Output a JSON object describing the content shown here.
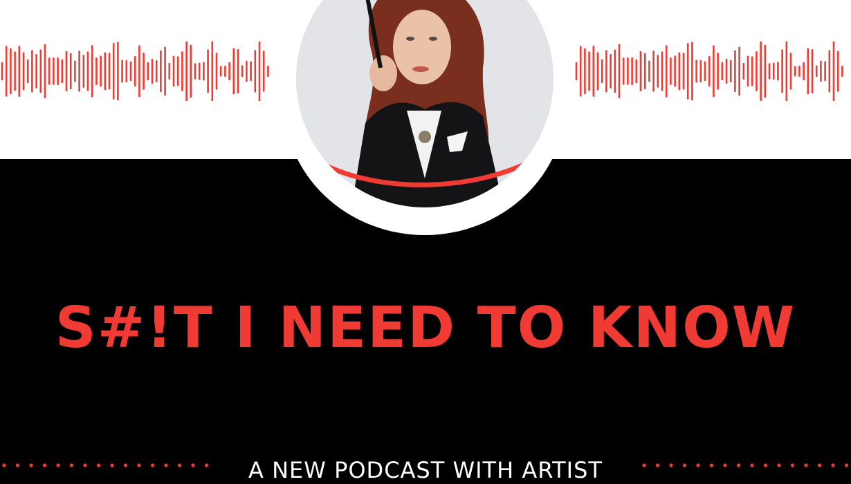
{
  "graphic": {
    "title": "S#!T I NEED TO KNOW",
    "subtitle": "A NEW PODCAST WITH ARTIST",
    "accent_color": "#ef3b34",
    "background_top": "#ffffff",
    "background_bottom": "#000000",
    "decorations": [
      "sound-wave-icon",
      "portrait-photo",
      "dotted-divider"
    ]
  }
}
